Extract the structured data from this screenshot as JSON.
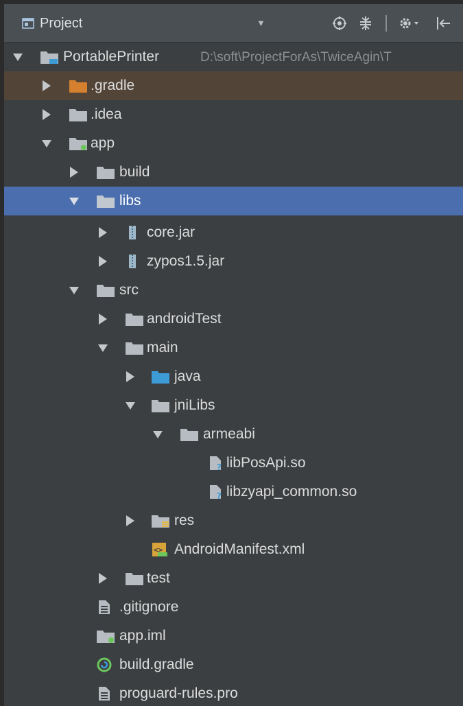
{
  "header": {
    "title": "Project",
    "dropdown": "▼"
  },
  "colors": {
    "panel_bg": "#3c3f41",
    "header_bg": "#4a4f53",
    "selection": "#4b6eaf",
    "excluded_row": "#524437",
    "folder": "#b6bcc2",
    "folder_orange": "#d5802e",
    "folder_blue": "#3d9bd6",
    "module_green": "#6bc75b"
  },
  "tree": {
    "root_label": "PortablePrinter",
    "root_path": "D:\\soft\\ProjectForAs\\TwiceAgin\\T",
    "items": [
      {
        "label": ".gradle"
      },
      {
        "label": ".idea"
      },
      {
        "label": "app"
      },
      {
        "label": "build"
      },
      {
        "label": "libs"
      },
      {
        "label": "core.jar"
      },
      {
        "label": "zypos1.5.jar"
      },
      {
        "label": "src"
      },
      {
        "label": "androidTest"
      },
      {
        "label": "main"
      },
      {
        "label": "java"
      },
      {
        "label": "jniLibs"
      },
      {
        "label": "armeabi"
      },
      {
        "label": "libPosApi.so"
      },
      {
        "label": "libzyapi_common.so"
      },
      {
        "label": "res"
      },
      {
        "label": "AndroidManifest.xml"
      },
      {
        "label": "test"
      },
      {
        "label": ".gitignore"
      },
      {
        "label": "app.iml"
      },
      {
        "label": "build.gradle"
      },
      {
        "label": "proguard-rules.pro"
      }
    ]
  }
}
